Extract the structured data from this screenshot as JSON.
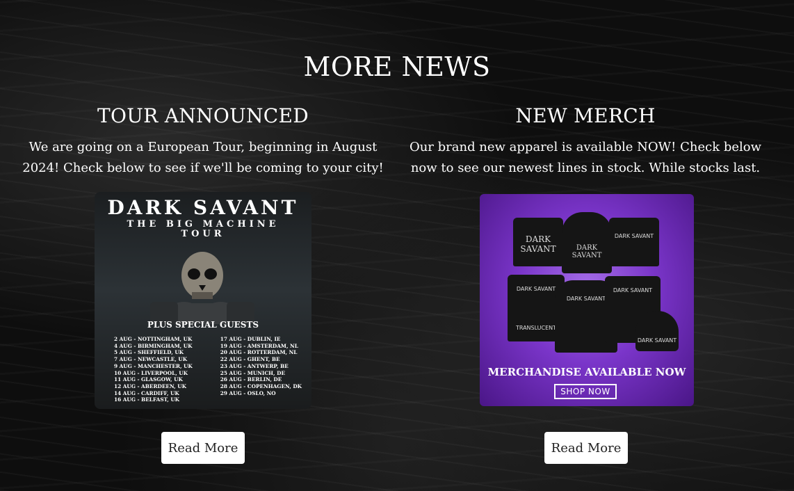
{
  "section": {
    "title": "MORE NEWS"
  },
  "news": [
    {
      "title": "TOUR ANNOUNCED",
      "text": "We are going on a European Tour, beginning in August 2024! Check below to see if we'll be coming to your city!",
      "button": "Read More",
      "poster": {
        "band": "DARK SAVANT",
        "tour_line1": "THE BIG MACHINE",
        "tour_line2": "TOUR",
        "guests": "PLUS SPECIAL GUESTS",
        "dates_left": [
          "2 AUG - NOTTINGHAM, UK",
          "4 AUG - BIRMINGHAM, UK",
          "5 AUG - SHEFFIELD, UK",
          "7 AUG - NEWCASTLE, UK",
          "9 AUG - MANCHESTER, UK",
          "10 AUG - LIVERPOOL, UK",
          "11 AUG - GLASGOW, UK",
          "12 AUG - ABERDEEN, UK",
          "14 AUG - CARDIFF, UK",
          "16 AUG - BELFAST, UK"
        ],
        "dates_right": [
          "17 AUG - DUBLIN, IE",
          "19 AUG - AMSTERDAM, NL",
          "20 AUG - ROTTERDAM, NL",
          "22 AUG - GHENT, BE",
          "23 AUG - ANTWERP, BE",
          "25 AUG - MUNICH, DE",
          "26 AUG - BERLIN, DE",
          "28 AUG - COPENHAGEN, DK",
          "29 AUG - OSLO, NO"
        ]
      }
    },
    {
      "title": "NEW MERCH",
      "text": "Our brand new apparel is available NOW! Check below now to see our newest lines in stock. While stocks last.",
      "button": "Read More",
      "merch": {
        "brand": "DARK SAVANT",
        "cta": "MERCHANDISE AVAILABLE NOW",
        "shop": "SHOP NOW",
        "shirt_label": "TRANSLUCENT"
      }
    }
  ],
  "colors": {
    "merch_bg": "#7a35c9",
    "button_bg": "#ffffff"
  }
}
